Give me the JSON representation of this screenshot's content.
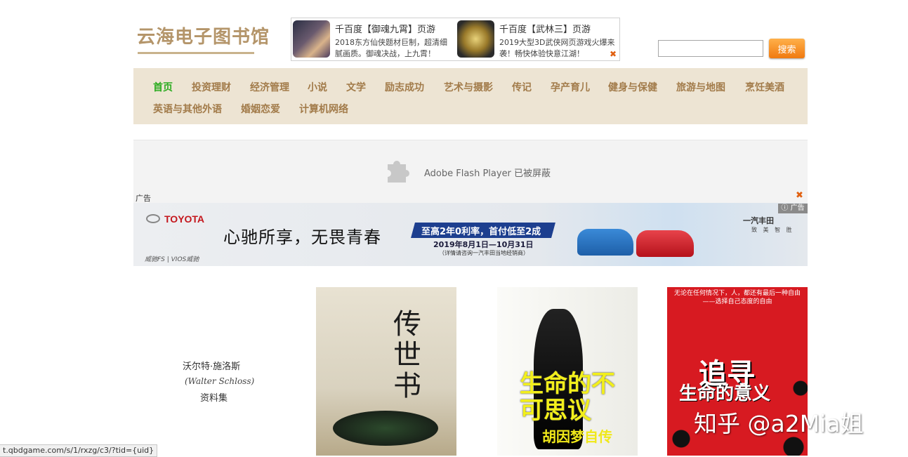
{
  "site": {
    "logo": "云海电子图书馆"
  },
  "top_ads": [
    {
      "title": "千百度【御魂九霄】页游",
      "desc": "2018东方仙侠题材巨制，超清细腻画质。御魂决战，上九霄！"
    },
    {
      "title": "千百度【武林三】页游",
      "desc": "2019大型3D武侠网页游戏火爆来袭！畅快体验快意江湖！"
    }
  ],
  "search": {
    "button_label": "搜索",
    "value": ""
  },
  "nav": {
    "items": [
      "首页",
      "投资理财",
      "经济管理",
      "小说",
      "文学",
      "励志成功",
      "艺术与摄影",
      "传记",
      "孕产育儿",
      "健身与保健",
      "旅游与地图",
      "烹饪美酒",
      "英语与其他外语",
      "婚姻恋爱",
      "计算机网络"
    ],
    "active": "首页"
  },
  "flash": {
    "message": "Adobe Flash Player 已被屏蔽"
  },
  "banner": {
    "ad_label": "广告",
    "ad_tag": "广告",
    "brand": "TOYOTA",
    "slogan": "心驰所享，无畏青春",
    "promo": "至高2年0利率，首付低至2成",
    "date": "2019年8月1日—10月31日",
    "note": "（详情请咨询一汽丰田当地经销商）",
    "model": "威驰FS | VIOS威驰",
    "dealer": "一汽丰田",
    "dealer_sub": "致 美 智 胜"
  },
  "books": [
    {
      "title": "沃尔特·施洛斯",
      "subtitle": "(Walter Schloss)",
      "extra": "资料集"
    },
    {
      "title": "传世书"
    },
    {
      "title": "生命的不可思议",
      "subtitle": "胡因梦自传"
    },
    {
      "title": "追寻",
      "subtitle": "生命的意义",
      "tagline": "无论在任何情况下，人，都还有最后一种自由——选择自己态度的自由"
    }
  ],
  "watermark": "知乎 @a2Mia姐",
  "status_bar": {
    "url": "t.qbdgame.com/s/1/rxzg/c3/?tid={uid}"
  }
}
